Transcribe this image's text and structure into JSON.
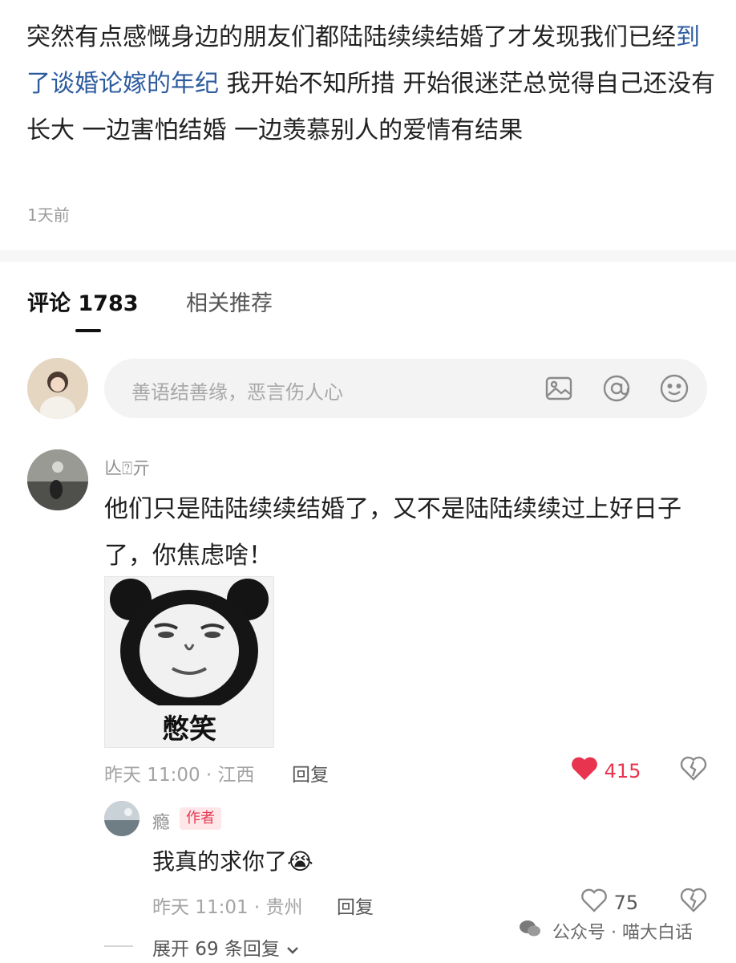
{
  "post": {
    "text_part1": "突然有点感慨身边的朋友们都陆陆续续结婚了才发现我们已经",
    "text_link": "到了谈婚论嫁的年纪",
    "text_part2": " 我开始不知所措 开始很迷茫总觉得自己还没有长大 一边害怕结婚 一边羡慕别人的爱情有结果",
    "time": "1天前"
  },
  "tabs": [
    {
      "label": "评论 1783",
      "active": true
    },
    {
      "label": "相关推荐",
      "active": false
    }
  ],
  "comment_input": {
    "placeholder": "善语结善缘，恶言伤人心",
    "icons": [
      "image-icon",
      "at-icon",
      "emoji-icon"
    ]
  },
  "comments": [
    {
      "username": "亾⍰亓",
      "text": "他们只是陆陆续续结婚了，又不是陆陆续续过上好日子了，你焦虑啥！",
      "sticker_caption": "憋笑",
      "time_location": "昨天 11:00 · 江西",
      "reply_label": "回复",
      "likes": "415",
      "liked": true,
      "like_color": "#e8344e"
    },
    {
      "username": "瘾",
      "badge": "作者",
      "text": "我真的求你了😭",
      "time_location": "昨天 11:01 · 贵州",
      "reply_label": "回复",
      "likes": "75",
      "liked": false
    }
  ],
  "expand_replies": "展开 69 条回复",
  "watermark": "公众号 · 喵大白话"
}
